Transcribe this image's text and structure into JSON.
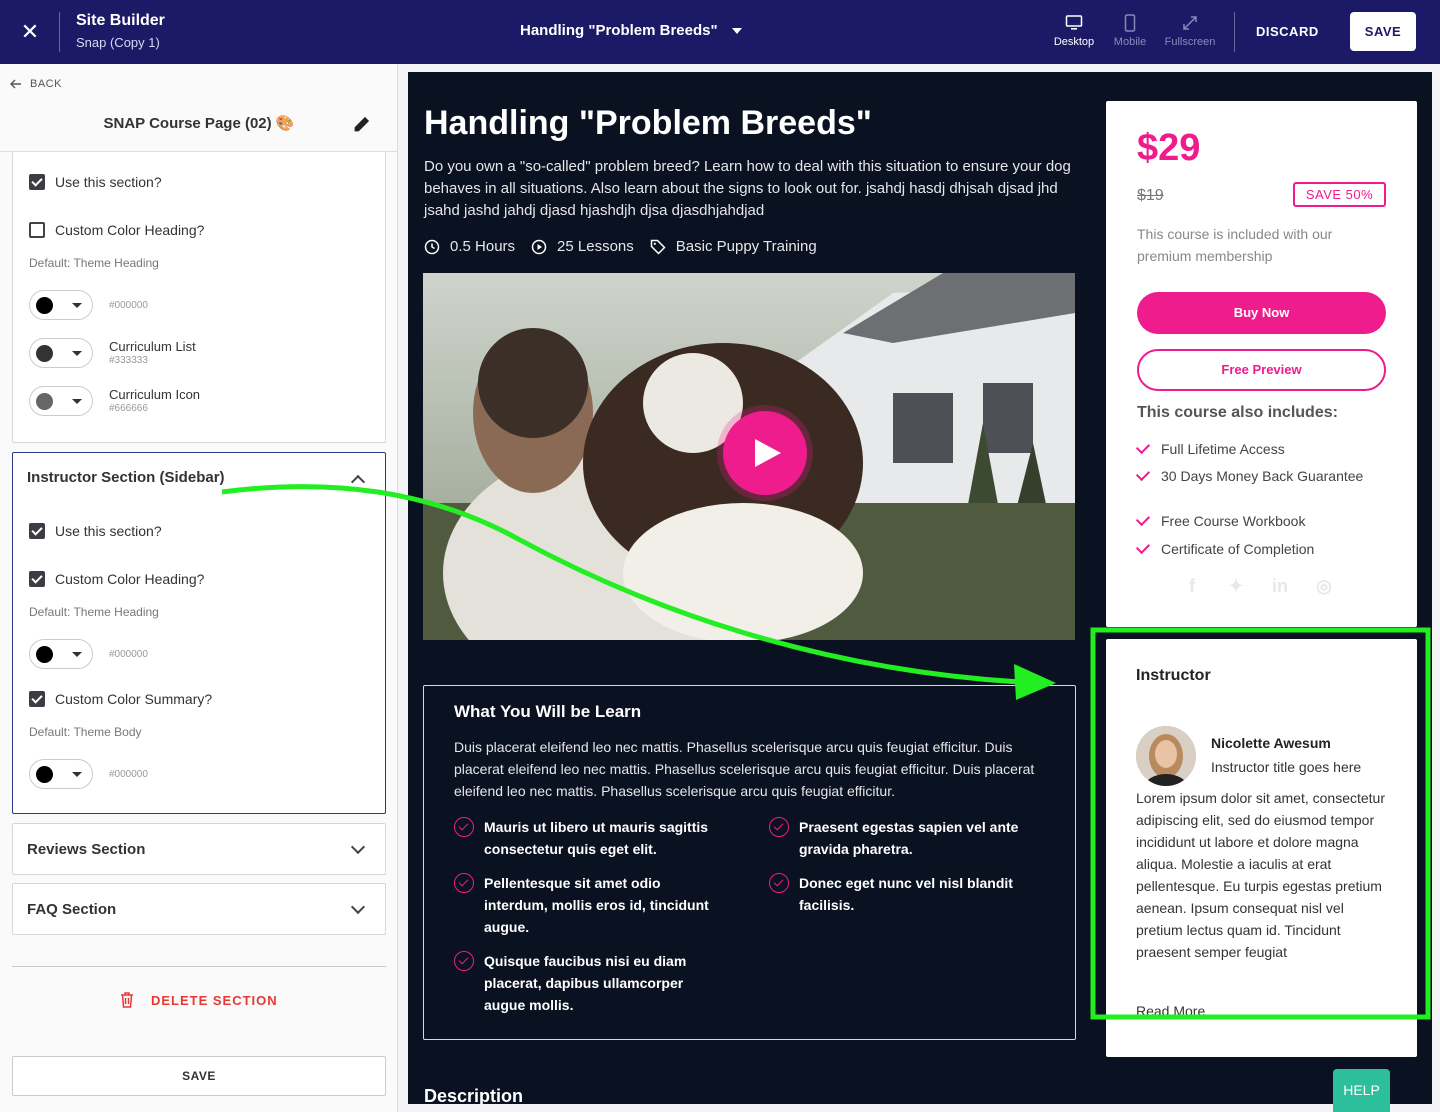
{
  "topbar": {
    "app_title": "Site Builder",
    "app_subtitle": "Snap (Copy 1)",
    "page_name": "Handling \"Problem Breeds\"",
    "devices": [
      {
        "label": "Desktop",
        "icon": "desktop-icon"
      },
      {
        "label": "Mobile",
        "icon": "mobile-icon"
      },
      {
        "label": "Fullscreen",
        "icon": "fullscreen-icon"
      }
    ],
    "discard_label": "DISCARD",
    "save_label": "SAVE",
    "bar_color": "#1c1a66"
  },
  "sidebar": {
    "back_label": "BACK",
    "title": "SNAP Course Page (02) 🎨",
    "curriculum_section": {
      "use_section_label": "Use this section?",
      "use_section_checked": true,
      "custom_heading_label": "Custom Color Heading?",
      "custom_heading_checked": false,
      "default_hint": "Default: Theme Heading",
      "heading_hex": "#000000",
      "list_label": "Curriculum List",
      "list_hex": "#333333",
      "icon_label": "Curriculum Icon",
      "icon_hex": "#666666"
    },
    "instructor_section": {
      "title": "Instructor Section (Sidebar)",
      "use_section_label": "Use this section?",
      "use_section_checked": true,
      "custom_heading_label": "Custom Color Heading?",
      "custom_heading_checked": true,
      "heading_hint": "Default: Theme Heading",
      "heading_hex": "#000000",
      "custom_summary_label": "Custom Color Summary?",
      "custom_summary_checked": true,
      "summary_hint": "Default: Theme Body",
      "summary_hex": "#000000"
    },
    "reviews_label": "Reviews Section",
    "faq_label": "FAQ Section",
    "delete_label": "DELETE SECTION",
    "save_label": "SAVE"
  },
  "preview": {
    "title": "Handling \"Problem Breeds\"",
    "description": "Do you own a \"so-called\" problem breed? Learn how to deal with this situation to ensure your dog behaves in all situations. Also learn about the signs to look out for. jsahdj hasdj dhjsah djsad jhd jsahd jashd jahdj djasd hjashdjh djsa djasdhjahdjad",
    "duration": "0.5 Hours",
    "lessons": "25 Lessons",
    "category": "Basic Puppy Training",
    "learn": {
      "heading": "What You Will be Learn",
      "paragraph": "Duis placerat eleifend leo nec mattis. Phasellus scelerisque arcu quis feugiat efficitur. Duis placerat eleifend leo nec mattis. Phasellus scelerisque arcu quis feugiat efficitur. Duis placerat eleifend leo nec mattis. Phasellus scelerisque arcu quis feugiat efficitur.",
      "items": [
        "Mauris ut libero ut mauris sagittis consectetur quis eget elit.",
        "Praesent egestas sapien vel ante gravida pharetra.",
        "Pellentesque sit amet odio interdum, mollis eros id, tincidunt augue.",
        "Donec eget nunc vel nisl blandit facilisis.",
        "Quisque faucibus nisi eu diam placerat, dapibus ullamcorper augue mollis."
      ]
    },
    "description_heading": "Description",
    "pricing": {
      "price": "$29",
      "old_price": "$19",
      "badge": "SAVE 50%",
      "included_note": "This course is included with our premium membership",
      "buy_label": "Buy Now",
      "preview_label": "Free Preview",
      "includes_heading": "This course also includes:",
      "features": [
        "Full Lifetime Access",
        "30 Days Money Back Guarantee",
        "Free Course Workbook",
        "Certificate of Completion"
      ],
      "accent_color": "#ee1c8c"
    },
    "instructor": {
      "heading": "Instructor",
      "name": "Nicolette Awesum",
      "role": "Instructor title goes here",
      "bio": "Lorem ipsum dolor sit amet, consectetur adipiscing elit, sed do eiusmod tempor incididunt ut labore et dolore magna aliqua. Molestie a iaculis at erat pellentesque. Eu turpis egestas pretium aenean. Ipsum consequat nisl vel pretium lectus quam id. Tincidunt praesent semper feugiat",
      "read_more": "Read More"
    },
    "background": "#0a1120"
  },
  "help_label": "HELP",
  "annotation_color": "#22ee22"
}
